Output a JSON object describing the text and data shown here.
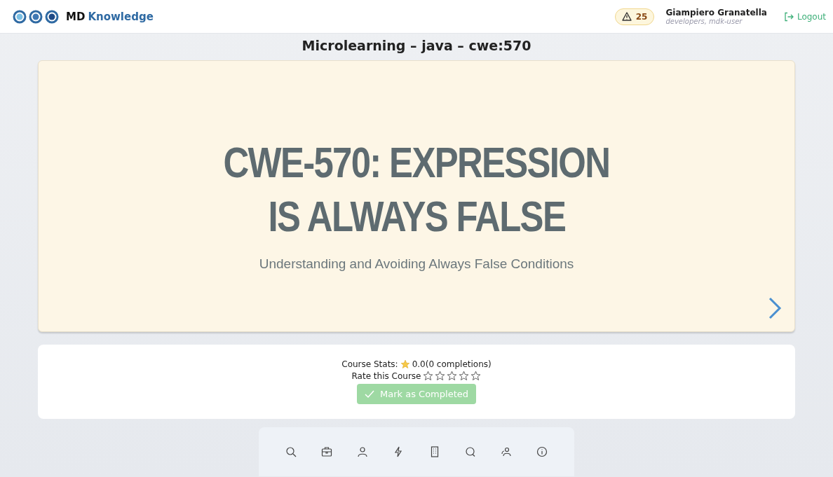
{
  "header": {
    "brand_prefix": "MD",
    "brand_name": "Knowledge",
    "alert_count": "25",
    "user_name": "Giampiero Granatella",
    "user_groups": "developers, mdk-user",
    "logout": "Logout"
  },
  "page_title": "Microlearning – java – cwe:570",
  "slide": {
    "title_lines": [
      "CWE-570: EXPRESSION",
      "IS ALWAYS FALSE"
    ],
    "subtitle": "Understanding and Avoiding Always False Conditions"
  },
  "stats": {
    "label": "Course Stats:",
    "rating": "0.0(0 completions)",
    "rate_label": "Rate this Course",
    "stars": 0,
    "complete_button": "Mark as Completed",
    "complete_disabled": true
  }
}
